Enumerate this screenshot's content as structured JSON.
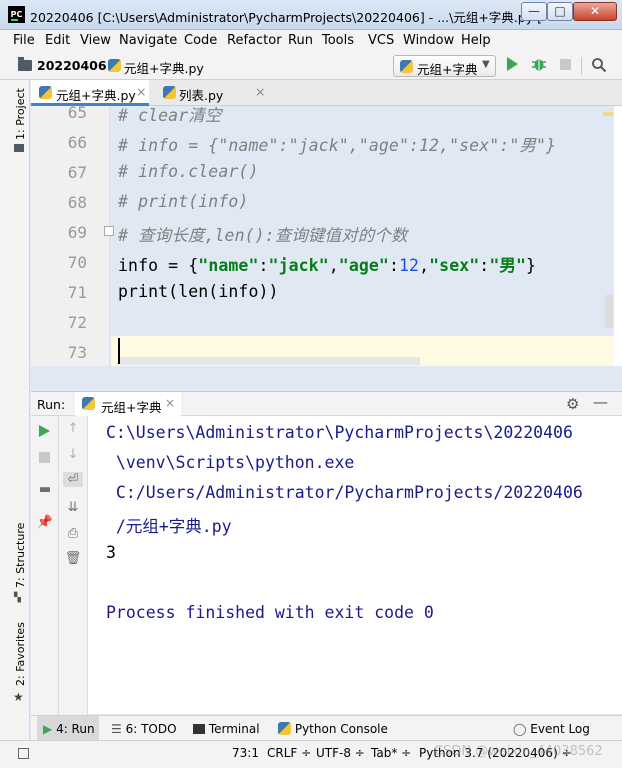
{
  "window": {
    "app_icon": "PC",
    "title": "20220406 [C:\\Users\\Administrator\\PycharmProjects\\20220406] - ...\\元组+字典.py [",
    "min_label": "—",
    "max_label": "□",
    "close_label": "✕"
  },
  "menu": {
    "items": [
      "File",
      "Edit",
      "View",
      "Navigate",
      "Code",
      "Refactor",
      "Run",
      "Tools",
      "VCS",
      "Window",
      "Help"
    ]
  },
  "navbar": {
    "project": "20220406",
    "file": "元组+字典.py",
    "run_config": "元组+字典"
  },
  "left_stripe": {
    "project_tab": "1: Project",
    "structure_tab": "7: Structure",
    "favorites_tab": "2: Favorites"
  },
  "editor": {
    "tabs": [
      {
        "label": "元组+字典.py",
        "close": "×",
        "active": true
      },
      {
        "label": "列表.py",
        "close": "×",
        "active": false
      }
    ],
    "line_numbers": [
      "65",
      "66",
      "67",
      "68",
      "69",
      "70",
      "71",
      "72",
      "73"
    ],
    "lines": {
      "l65": "# clear清空",
      "l66": "# info = {\"name\":\"jack\",\"age\":12,\"sex\":\"男\"}",
      "l67": "# info.clear()",
      "l68": "# print(info)",
      "l69": "# 查询长度,len():查询键值对的个数",
      "l70_a": "info = {",
      "l70_s1": "\"name\"",
      "l70_c1": ":",
      "l70_s2": "\"jack\"",
      "l70_c2": ",",
      "l70_s3": "\"age\"",
      "l70_c3": ":",
      "l70_n1": "12",
      "l70_c4": ",",
      "l70_s4": "\"sex\"",
      "l70_c5": ":",
      "l70_s5": "\"男\"",
      "l70_c6": "}",
      "l71": "print(len(info))",
      "l72": "",
      "l73": ""
    },
    "cursor_position": "73:1"
  },
  "run_panel": {
    "label": "Run:",
    "tab": "元组+字典",
    "tab_close": "×",
    "console": [
      "C:\\Users\\Administrator\\PycharmProjects\\20220406",
      " \\venv\\Scripts\\python.exe",
      " C:/Users/Administrator/PycharmProjects/20220406",
      " /元组+字典.py",
      "3",
      "",
      "Process finished with exit code 0"
    ]
  },
  "bottom_tabs": {
    "run": "4: Run",
    "todo": "6: TODO",
    "terminal": "Terminal",
    "python_console": "Python Console",
    "event_log": "Event Log"
  },
  "status_bar": {
    "position": "73:1",
    "line_separator": "CRLF ÷",
    "encoding": "UTF-8 ÷",
    "indent": "Tab* ÷",
    "interpreter": "Python 3.7 (20220406) ÷"
  },
  "watermark": "CSDN @weixin_44038562",
  "colors": {
    "string": "#067d17",
    "number": "#1750eb",
    "comment": "#808080",
    "console_text": "#1a1a8c",
    "caret_row": "#fffae3",
    "active_tab_underline": "#4083c9"
  }
}
